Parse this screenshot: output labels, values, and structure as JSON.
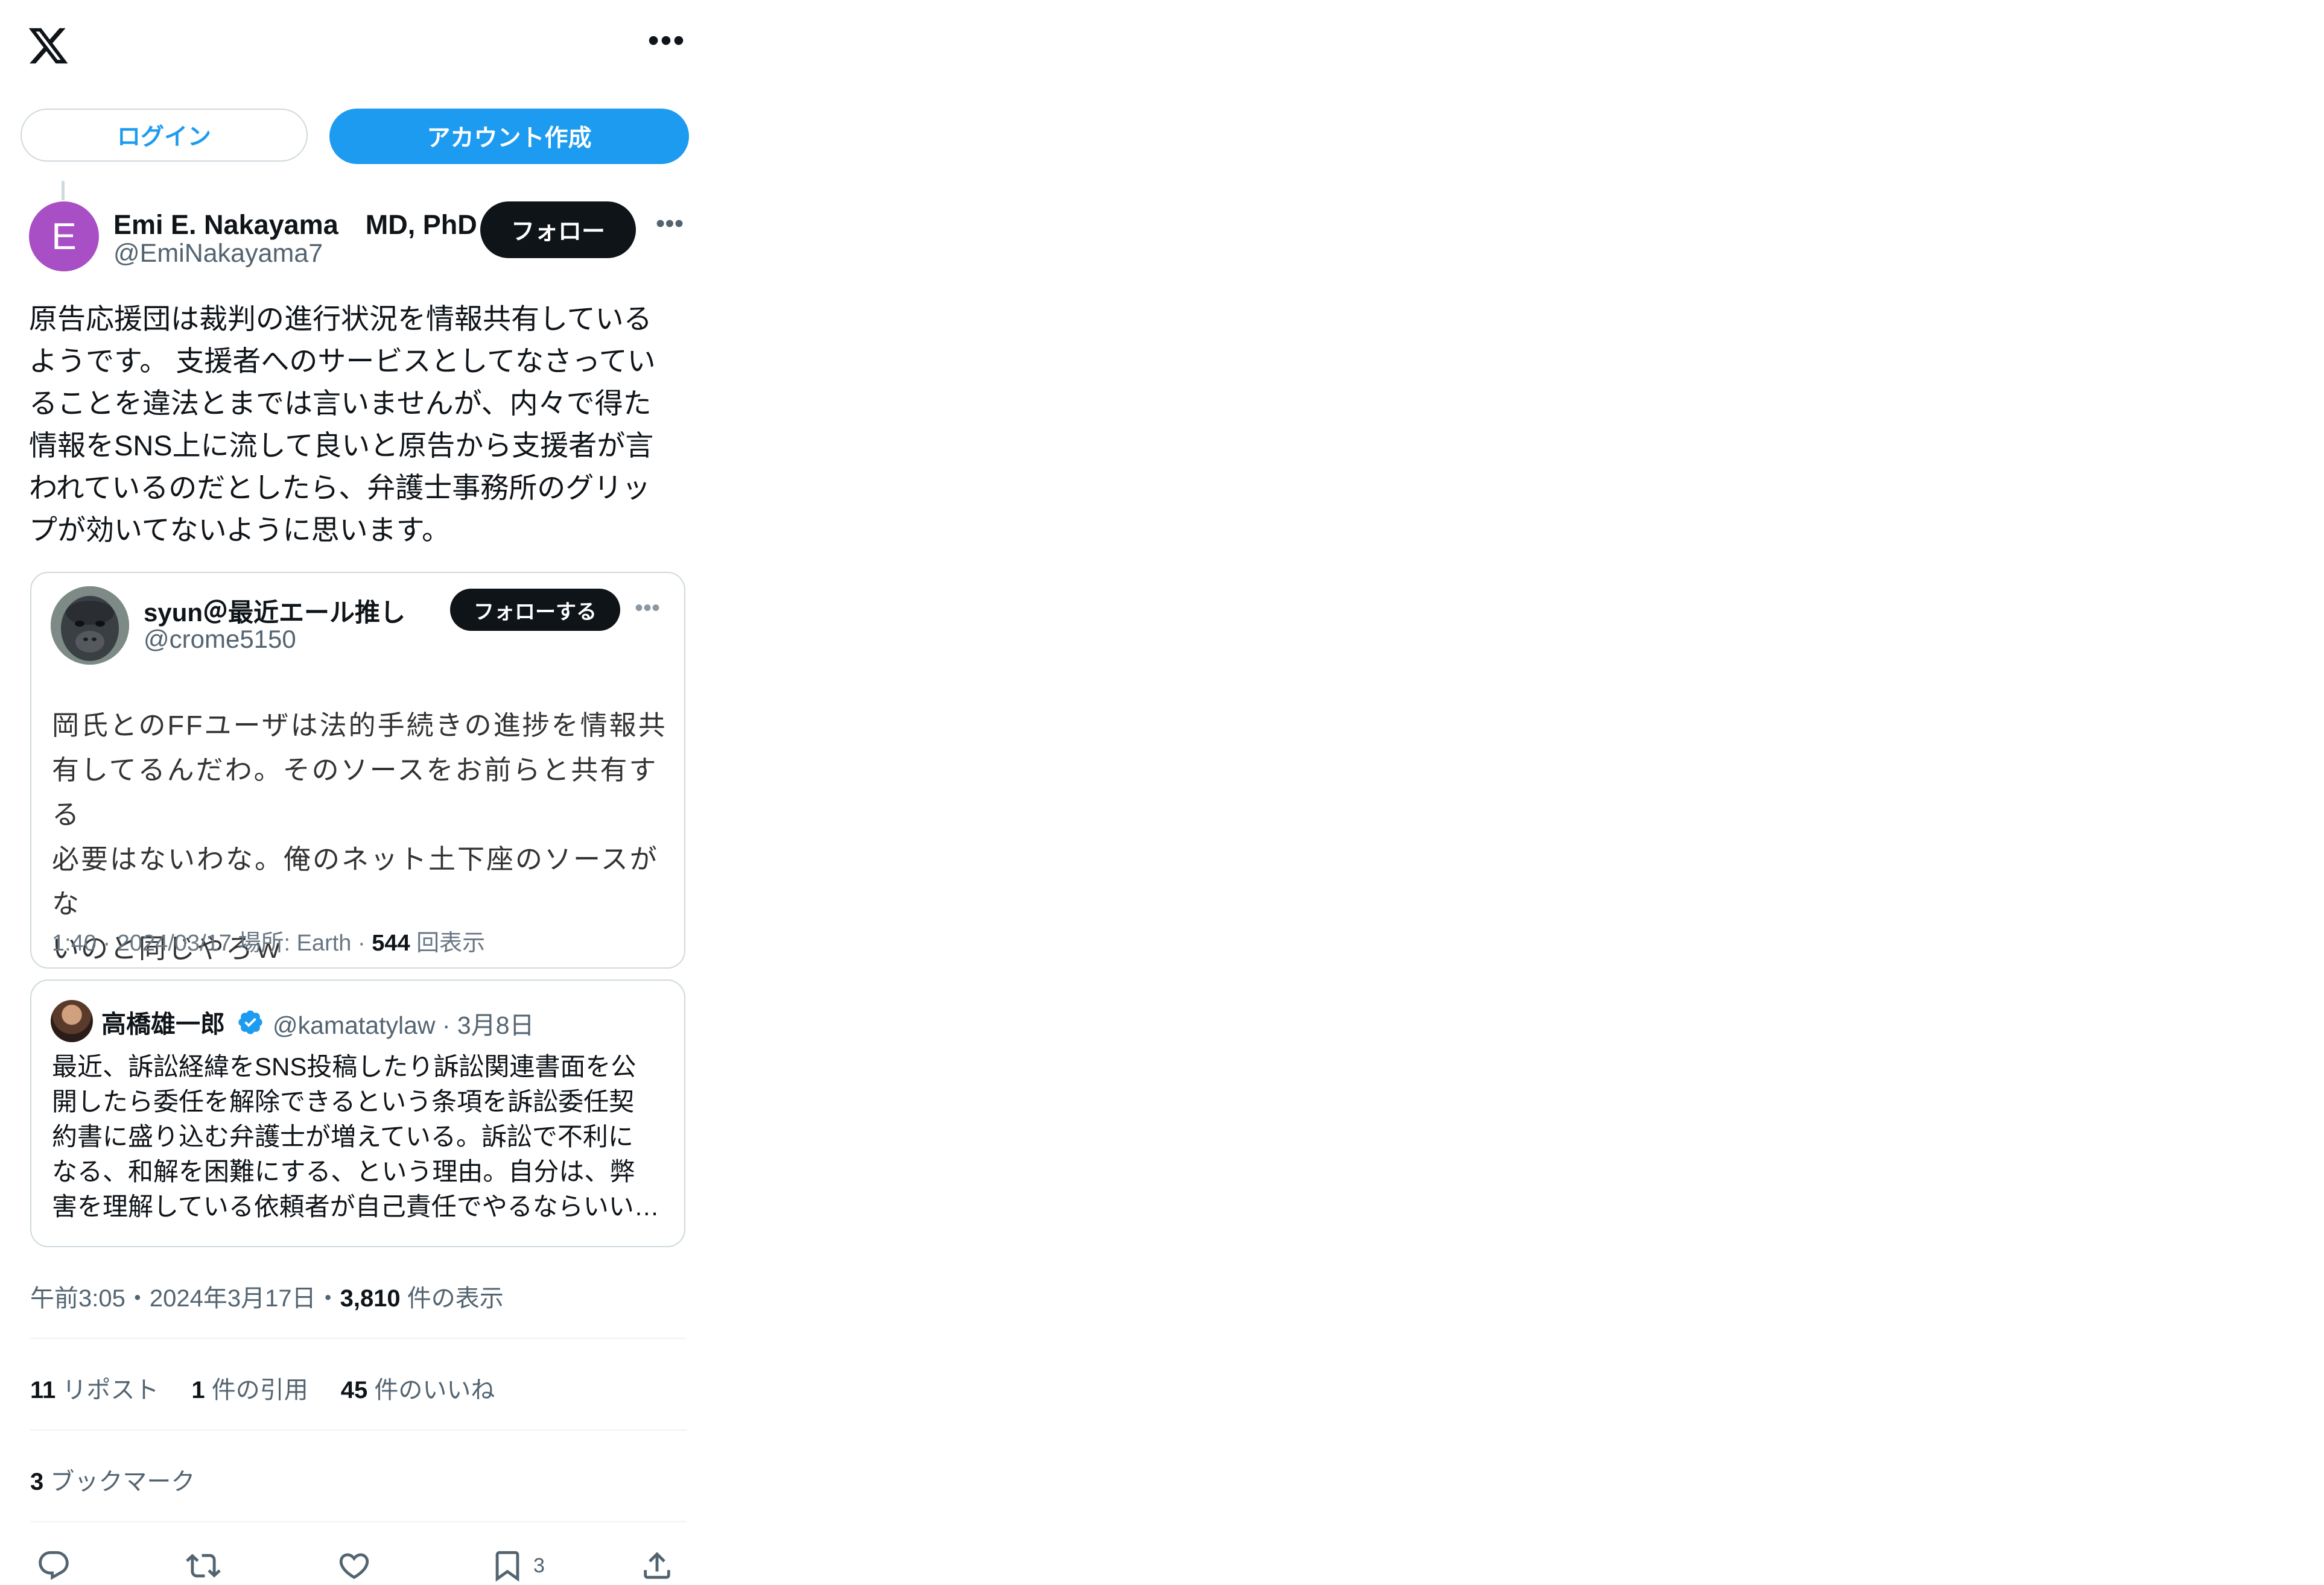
{
  "header": {
    "logo_icon": "x-logo-icon",
    "more_icon": "more-horizontal-icon",
    "more_text": "•••"
  },
  "auth": {
    "login_label": "ログイン",
    "signup_label": "アカウント作成"
  },
  "tweet": {
    "avatar_letter": "E",
    "author_name": "Emi E. Nakayama　MD, PhD",
    "author_handle": "@EmiNakayama7",
    "follow_label": "フォロー",
    "more_text": "•••",
    "text": "原告応援団は裁判の進行状況を情報共有している\nようです。 支援者へのサービスとしてなさってい\nることを違法とまでは言いませんが、内々で得た\n情報をSNS上に流して良いと原告から支援者が言\nわれているのだとしたら、弁護士事務所のグリッ\nプが効いてないように思います。",
    "timestamp_prefix": "午前3:05・2024年3月17日・",
    "view_count": "3,810",
    "view_label": " 件の表示",
    "stats": {
      "reposts_count": "11",
      "reposts_label": " リポスト",
      "quotes_count": "1",
      "quotes_label": " 件の引用",
      "likes_count": "45",
      "likes_label": " 件のいいね"
    },
    "bookmarks_count": "3",
    "bookmarks_label": " ブックマーク",
    "actions": {
      "reply_icon": "reply-icon",
      "repost_icon": "repost-icon",
      "like_icon": "heart-icon",
      "bookmark_icon": "bookmark-icon",
      "bookmark_count": "3",
      "share_icon": "share-icon"
    }
  },
  "quote_embed": {
    "author_name": "syun＠最近エール推し",
    "author_handle": "@crome5150",
    "follow_label": "フォローする",
    "more_text": "•••",
    "text": "岡氏とのFFユーザは法的手続きの進捗を情報共\n有してるんだわ。そのソースをお前らと共有する\n必要はないわな。俺のネット土下座のソースがな\nいのと同じやろｗ",
    "meta_prefix": "1:40 · 2024/03/17 場所: Earth · ",
    "views": "544",
    "views_label": " 回表示"
  },
  "quoted_tweet": {
    "author_name": "高橋雄一郎",
    "verified_icon": "verified-badge-icon",
    "author_handle": "@kamatatylaw",
    "date": "3月8日",
    "handle_date_sep": " · ",
    "text": "最近、訴訟経緯をSNS投稿したり訴訟関連書面を公\n開したら委任を解除できるという条項を訴訟委任契\n約書に盛り込む弁護士が増えている。訴訟で不利に\nなる、和解を困難にする、という理由。自分は、弊\n害を理解している依頼者が自己責任でやるならいい…"
  },
  "colors": {
    "accent": "#1d9bf0",
    "text": "#0f1419",
    "secondary": "#536471",
    "border": "#cfd9de",
    "avatar": "#a94fc5"
  }
}
